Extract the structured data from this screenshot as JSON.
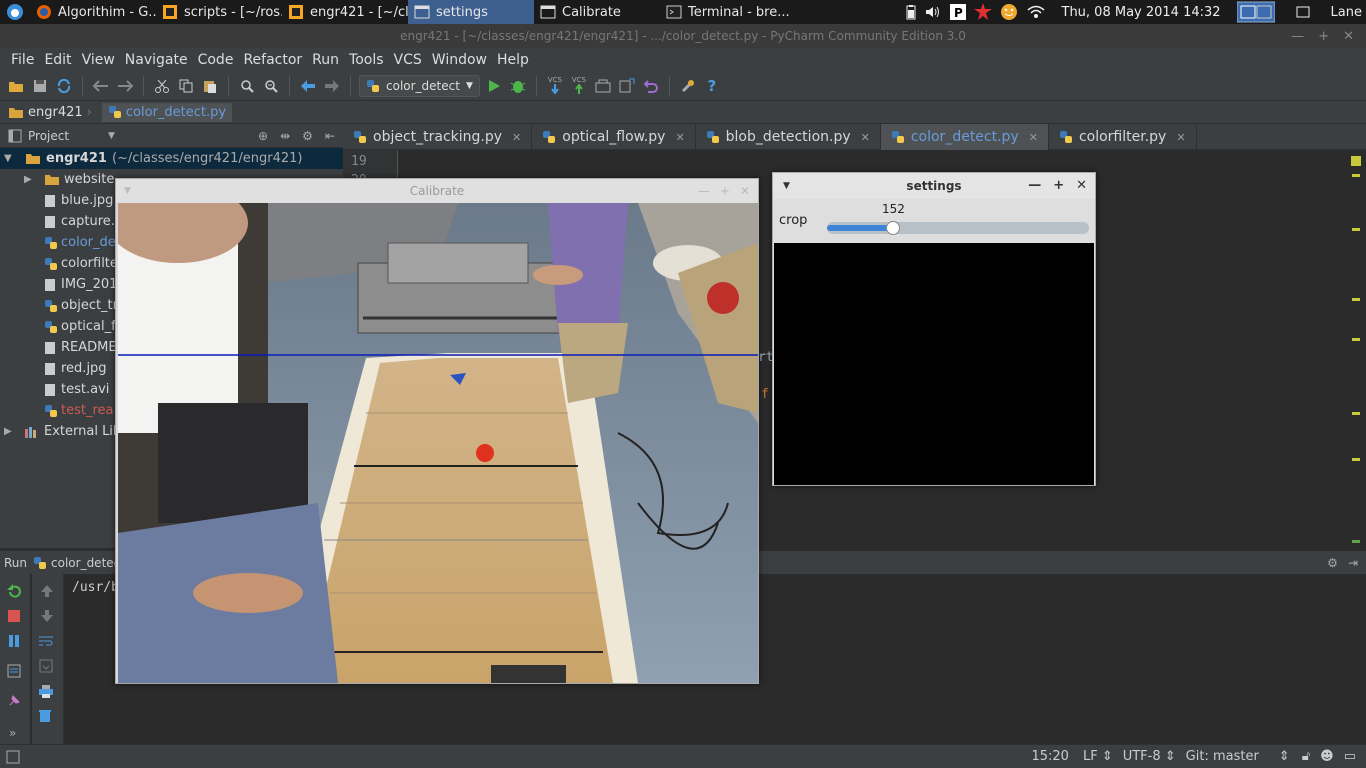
{
  "taskbar": {
    "items": [
      {
        "label": "Algorithim - G...",
        "icon": "firefox-icon"
      },
      {
        "label": "scripts - [~/ros...",
        "icon": "pycharm-icon"
      },
      {
        "label": "engr421 - [~/cl...",
        "icon": "pycharm-icon"
      },
      {
        "label": "settings",
        "icon": "window-icon",
        "active": true
      },
      {
        "label": "Calibrate",
        "icon": "window-icon"
      },
      {
        "label": "Terminal - bre...",
        "icon": "terminal-icon"
      }
    ],
    "clock": "Thu, 08 May 2014 14:32",
    "user": "Lane"
  },
  "window": {
    "title": "engr421 - [~/classes/engr421/engr421] - .../color_detect.py - PyCharm Community Edition 3.0"
  },
  "menu": [
    "File",
    "Edit",
    "View",
    "Navigate",
    "Code",
    "Refactor",
    "Run",
    "Tools",
    "VCS",
    "Window",
    "Help"
  ],
  "toolbar": {
    "run_config": "color_detect",
    "vcs1": "VCS",
    "vcs2": "VCS",
    "help": "?"
  },
  "breadcrumb": {
    "project": "engr421",
    "file": "color_detect.py"
  },
  "project_panel": {
    "title": "Project",
    "root": "engr421",
    "root_path": "(~/classes/engr421/engr421)",
    "items": [
      {
        "label": "website",
        "type": "folder"
      },
      {
        "label": "blue.jpg",
        "type": "file"
      },
      {
        "label": "capture.",
        "type": "file"
      },
      {
        "label": "color_de",
        "type": "py",
        "color": "#6a9bd8"
      },
      {
        "label": "colorfilte",
        "type": "py"
      },
      {
        "label": "IMG_201",
        "type": "file"
      },
      {
        "label": "object_tr",
        "type": "py"
      },
      {
        "label": "optical_f",
        "type": "py"
      },
      {
        "label": "README",
        "type": "file"
      },
      {
        "label": "red.jpg",
        "type": "file"
      },
      {
        "label": "test.avi",
        "type": "file"
      },
      {
        "label": "test_rea",
        "type": "py",
        "color": "#cc5b4f"
      }
    ],
    "external": "External Lib"
  },
  "tabs": [
    {
      "label": "object_tracking.py",
      "active": false
    },
    {
      "label": "optical_flow.py",
      "active": false
    },
    {
      "label": "blob_detection.py",
      "active": false
    },
    {
      "label": "color_detect.py",
      "active": true
    },
    {
      "label": "colorfilter.py",
      "active": false
    }
  ],
  "editor": {
    "line_numbers": [
      "19",
      "20"
    ],
    "fragment1": "rt",
    "fragment2": "f"
  },
  "run_panel": {
    "title": "Run",
    "config": "color_detec",
    "output": "/usr/b"
  },
  "calibrate": {
    "title": "Calibrate"
  },
  "settings": {
    "title": "settings",
    "trackbar_label": "crop",
    "trackbar_value": "152",
    "trackbar_fraction": 0.2
  },
  "status": {
    "position": "15:20",
    "line_sep": "LF",
    "encoding": "UTF-8",
    "git": "Git: master"
  },
  "colors": {
    "accent": "#6a9bd8",
    "selection": "#0d293e"
  }
}
